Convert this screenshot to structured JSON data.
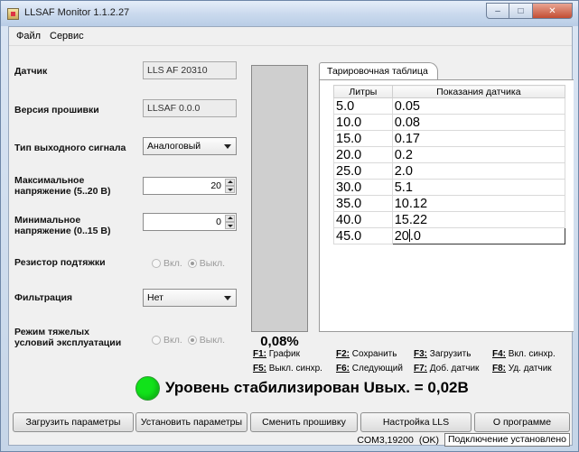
{
  "window": {
    "title": "LLSAF Monitor 1.1.2.27"
  },
  "menu": [
    "Файл",
    "Сервис"
  ],
  "fields": {
    "sensor": {
      "label": "Датчик",
      "value": "LLS AF 20310"
    },
    "firmware": {
      "label": "Версия прошивки",
      "value": "LLSAF 0.0.0"
    },
    "output_type": {
      "label": "Тип выходного сигнала",
      "value": "Аналоговый"
    },
    "max_voltage": {
      "label_line1": "Максимальное",
      "label_line2": "напряжение (5..20 В)",
      "value": "20"
    },
    "min_voltage": {
      "label_line1": "Минимальное",
      "label_line2": "напряжение (0..15 В)",
      "value": "0"
    },
    "pullup": {
      "label": "Резистор подтяжки",
      "on": "Вкл.",
      "off": "Выкл.",
      "selected": "off"
    },
    "filter": {
      "label": "Фильтрация",
      "value": "Нет"
    },
    "heavy_mode": {
      "label_line1": "Режим тяжелых",
      "label_line2": "условий эксплуатации",
      "on": "Вкл.",
      "off": "Выкл.",
      "selected": "off"
    }
  },
  "gauge": {
    "percent_text": "0,08%",
    "fill_fraction": 0.0008,
    "fill_color": "#5aa3e8"
  },
  "calibration": {
    "tab_label": "Тарировочная таблица",
    "columns": [
      "Литры",
      "Показания датчика"
    ],
    "rows": [
      [
        "5.0",
        "0.05"
      ],
      [
        "10.0",
        "0.08"
      ],
      [
        "15.0",
        "0.17"
      ],
      [
        "20.0",
        "0.2"
      ],
      [
        "25.0",
        "2.0"
      ],
      [
        "30.0",
        "5.1"
      ],
      [
        "35.0",
        "10.12"
      ],
      [
        "40.0",
        "15.22"
      ],
      [
        "45.0",
        "20.0"
      ]
    ]
  },
  "shortcuts": [
    {
      "key": "F1:",
      "text": " График"
    },
    {
      "key": "F2:",
      "text": " Сохранить"
    },
    {
      "key": "F3:",
      "text": " Загрузить"
    },
    {
      "key": "F4:",
      "text": " Вкл. синхр."
    },
    {
      "key": "F5:",
      "text": " Выкл. синхр."
    },
    {
      "key": "F6:",
      "text": " Следующий"
    },
    {
      "key": "F7:",
      "text": " Доб. датчик"
    },
    {
      "key": "F8:",
      "text": " Уд. датчик"
    }
  ],
  "status": {
    "text": "Уровень стабилизирован Uвых. = 0,02В",
    "led_color": "#11e21a"
  },
  "buttons": [
    "Загрузить параметры",
    "Установить параметры",
    "Сменить прошивку",
    "Настройка LLS",
    "О программе"
  ],
  "statusbar": {
    "port": "COM3,19200",
    "ok": "(OK)",
    "connection": "Подключение установлено"
  }
}
